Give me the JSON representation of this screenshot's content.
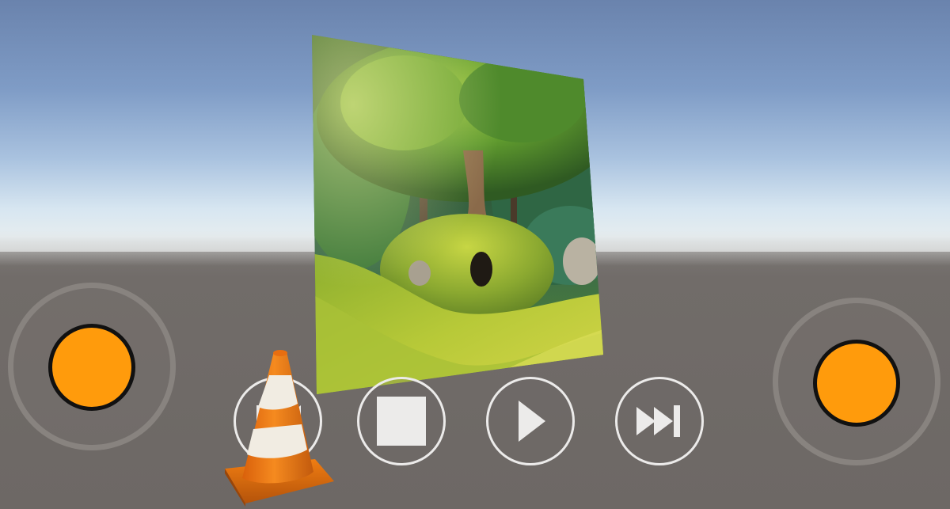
{
  "scene": {
    "colors": {
      "sky_top": "#6a83ad",
      "horizon": "#e6edf0",
      "ground": "#6d6865",
      "joystick_knob": "#ff9b0c",
      "button_outline": "#ecebea",
      "cone_orange": "#f07d12"
    }
  },
  "video": {
    "icon": "forest-tree-video-frame"
  },
  "controls": {
    "prev": {
      "icon": "skip-back-icon"
    },
    "stop": {
      "icon": "stop-icon"
    },
    "play": {
      "icon": "play-icon"
    },
    "next": {
      "icon": "skip-forward-icon"
    }
  },
  "joysticks": {
    "left": {
      "icon": "left-virtual-joystick"
    },
    "right": {
      "icon": "right-virtual-joystick"
    }
  },
  "logo": {
    "icon": "vlc-cone-logo"
  }
}
